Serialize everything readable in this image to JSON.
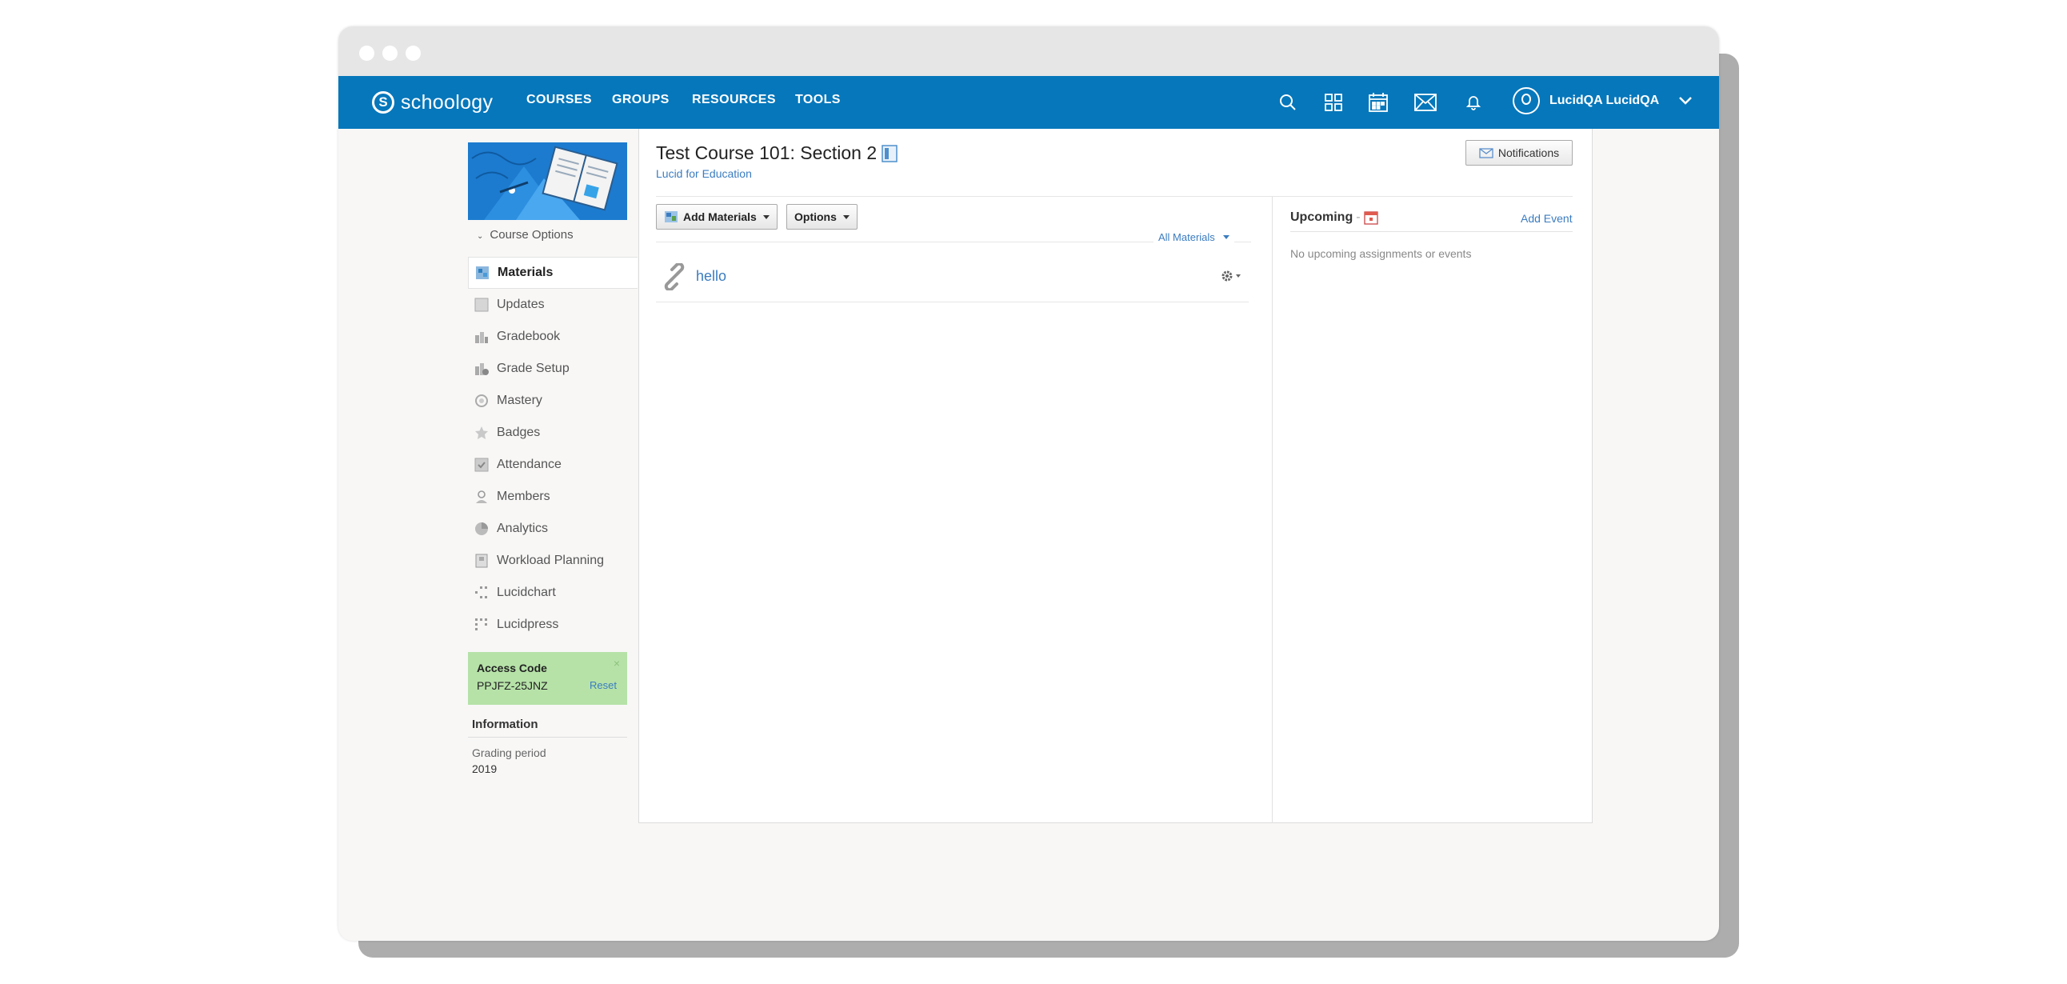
{
  "topnav": {
    "logo_text": "schoology",
    "links": [
      "COURSES",
      "GROUPS",
      "RESOURCES",
      "TOOLS"
    ],
    "icons": [
      "search-icon",
      "apps-grid-icon",
      "calendar-icon",
      "mail-icon",
      "bell-icon"
    ],
    "user_name": "LucidQA LucidQA",
    "bar_color": "#0677bb"
  },
  "sidebar": {
    "course_options": "Course Options",
    "items": [
      {
        "label": "Materials",
        "icon": "materials-icon",
        "active": true
      },
      {
        "label": "Updates",
        "icon": "updates-icon"
      },
      {
        "label": "Gradebook",
        "icon": "gradebook-icon"
      },
      {
        "label": "Grade Setup",
        "icon": "grade-setup-icon"
      },
      {
        "label": "Mastery",
        "icon": "mastery-icon"
      },
      {
        "label": "Badges",
        "icon": "badges-icon"
      },
      {
        "label": "Attendance",
        "icon": "attendance-icon"
      },
      {
        "label": "Members",
        "icon": "members-icon"
      },
      {
        "label": "Analytics",
        "icon": "analytics-icon"
      },
      {
        "label": "Workload Planning",
        "icon": "workload-icon"
      },
      {
        "label": "Lucidchart",
        "icon": "lucidchart-icon"
      },
      {
        "label": "Lucidpress",
        "icon": "lucidpress-icon"
      }
    ],
    "access_code": {
      "label": "Access Code",
      "code": "PPJFZ-25JNZ",
      "reset": "Reset",
      "close": "×"
    },
    "information": {
      "heading": "Information",
      "grading_label": "Grading period",
      "grading_value": "2019"
    }
  },
  "course": {
    "title": "Test Course 101: Section 2",
    "subtitle": "Lucid for Education",
    "notifications_label": "Notifications"
  },
  "materials": {
    "add_materials_label": "Add Materials",
    "options_label": "Options",
    "filter_label": "All Materials",
    "items": [
      {
        "title": "hello",
        "icon": "link-icon"
      }
    ]
  },
  "upcoming": {
    "heading": "Upcoming",
    "add_event": "Add Event",
    "empty_text": "No upcoming assignments or events"
  }
}
